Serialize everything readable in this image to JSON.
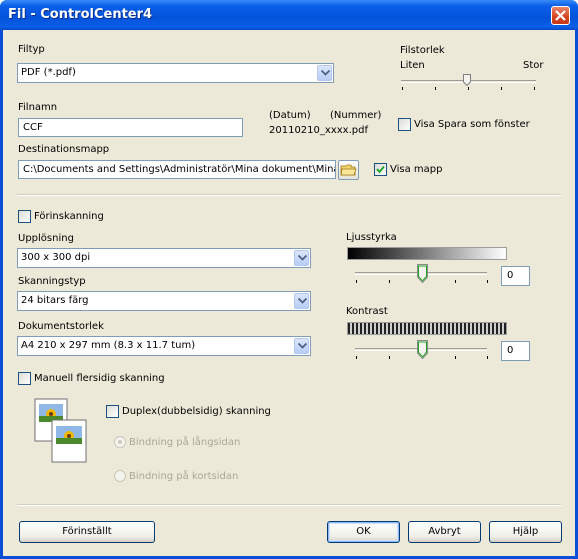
{
  "window": {
    "title": "Fil - ControlCenter4"
  },
  "file_type": {
    "label": "Filtyp",
    "value": "PDF (*.pdf)"
  },
  "file_size": {
    "label": "Filstorlek",
    "min_label": "Liten",
    "max_label": "Stor",
    "level": 0.42
  },
  "file_name": {
    "label": "Filnamn",
    "value": "CCF",
    "date_label": "(Datum)",
    "number_label": "(Nummer)",
    "pattern": "20110210_xxxx.pdf"
  },
  "show_save_as": {
    "label": "Visa Spara som fönster",
    "checked": false
  },
  "destination": {
    "label": "Destinationsmapp",
    "value": "C:\\Documents and Settings\\Administratör\\Mina dokument\\Mina l"
  },
  "show_folder": {
    "label": "Visa mapp",
    "checked": true
  },
  "prescan": {
    "label": "Förinskanning",
    "checked": false
  },
  "resolution": {
    "label": "Upplösning",
    "value": "300 x 300 dpi"
  },
  "scan_type": {
    "label": "Skanningstyp",
    "value": "24 bitars färg"
  },
  "doc_size": {
    "label": "Dokumentstorlek",
    "value": "A4 210 x 297 mm (8.3 x 11.7 tum)"
  },
  "brightness": {
    "label": "Ljusstyrka",
    "value": "0",
    "level": 0.5
  },
  "contrast": {
    "label": "Kontrast",
    "value": "0",
    "level": 0.5
  },
  "manual_duplex": {
    "label": "Manuell flersidig skanning",
    "checked": false
  },
  "duplex": {
    "label": "Duplex(dubbelsidig) skanning",
    "checked": false
  },
  "binding_long": {
    "label": "Bindning på långsidan"
  },
  "binding_short": {
    "label": "Bindning på kortsidan"
  },
  "buttons": {
    "default": "Förinställt",
    "ok": "OK",
    "cancel": "Avbryt",
    "help": "Hjälp"
  }
}
